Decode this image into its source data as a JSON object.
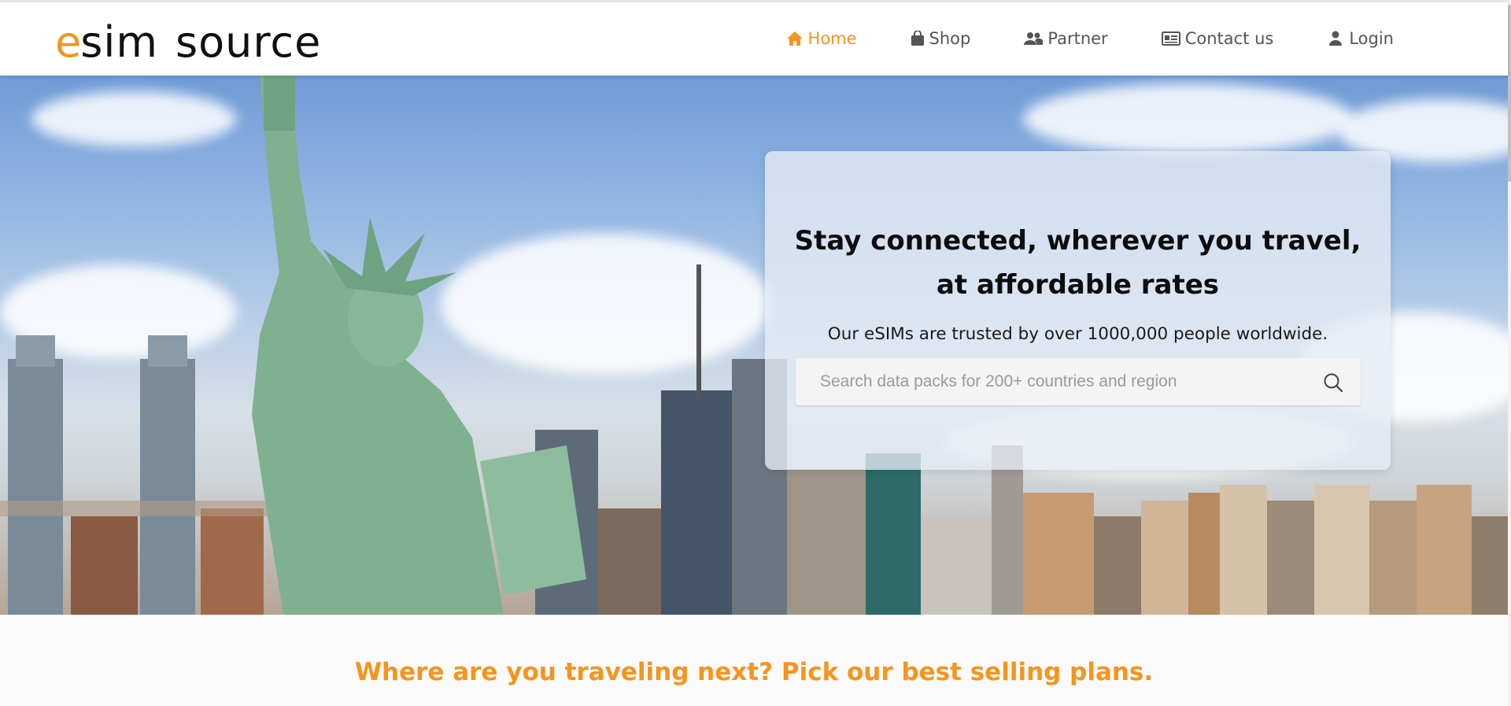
{
  "brand": {
    "logo_first": "e",
    "logo_rest_1": "sim",
    "logo_rest_2": "source",
    "accent": "#f7941d"
  },
  "nav": {
    "items": [
      {
        "label": "Home",
        "icon": "home-icon",
        "active": true
      },
      {
        "label": "Shop",
        "icon": "shopping-bag-icon",
        "active": false
      },
      {
        "label": "Partner",
        "icon": "users-icon",
        "active": false
      },
      {
        "label": "Contact us",
        "icon": "id-card-icon",
        "active": false
      },
      {
        "label": "Login",
        "icon": "user-icon",
        "active": false
      }
    ]
  },
  "hero": {
    "title_line1": "Stay connected, wherever you travel,",
    "title_line2": "at affordable rates",
    "subtitle": "Our eSIMs are trusted by over 1000,000 people worldwide.",
    "search": {
      "placeholder": "Search data packs for 200+ countries and region",
      "value": ""
    }
  },
  "section": {
    "heading": "Where are you traveling next? Pick our best selling plans."
  }
}
